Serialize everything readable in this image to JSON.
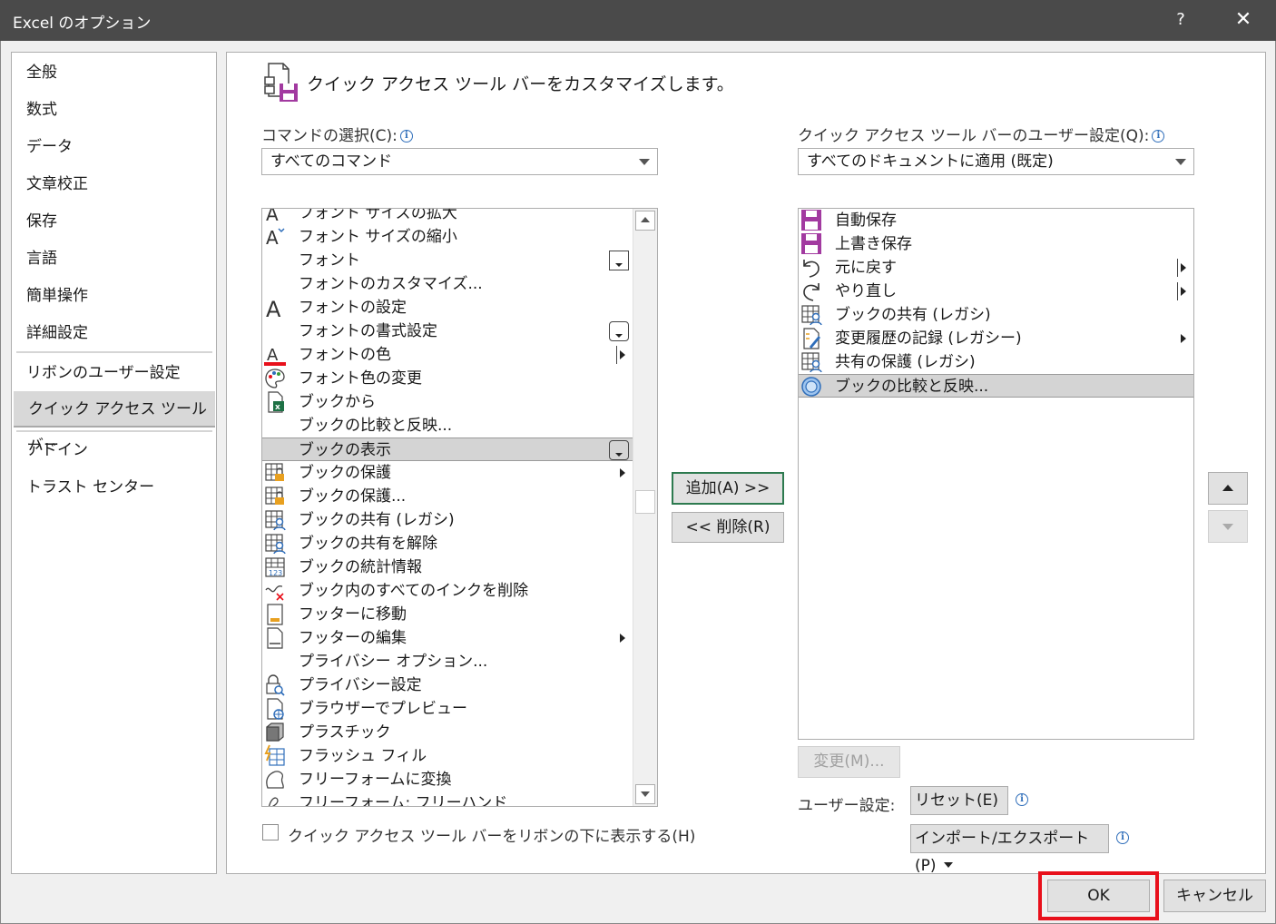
{
  "window": {
    "title": "Excel のオプション",
    "help": "?",
    "close": "✕"
  },
  "nav": {
    "items": [
      {
        "label": "全般"
      },
      {
        "label": "数式"
      },
      {
        "label": "データ"
      },
      {
        "label": "文章校正"
      },
      {
        "label": "保存"
      },
      {
        "label": "言語"
      },
      {
        "label": "簡単操作"
      },
      {
        "label": "詳細設定"
      },
      {
        "label": "リボンのユーザー設定"
      },
      {
        "label": "クイック アクセス ツール バー"
      },
      {
        "label": "アドイン"
      },
      {
        "label": "トラスト センター"
      }
    ],
    "active": "クイック アクセス ツール バー"
  },
  "main": {
    "heading": "クイック アクセス ツール バーをカスタマイズします。",
    "commands_label": "コマンドの選択(C):",
    "commands_value": "すべてのコマンド",
    "qat_label": "クイック アクセス ツール バーのユーザー設定(Q):",
    "qat_value": "すべてのドキュメントに適用 (既定)",
    "commands": [
      {
        "label": "フォント サイズの拡大",
        "icon": "font-grow-icon"
      },
      {
        "label": "フォント サイズの縮小",
        "icon": "font-shrink-icon"
      },
      {
        "label": "フォント",
        "icon": "none",
        "extra": "font-box"
      },
      {
        "label": "フォントのカスタマイズ...",
        "icon": "none"
      },
      {
        "label": "フォントの設定",
        "icon": "font-icon"
      },
      {
        "label": "フォントの書式設定",
        "icon": "none",
        "extra": "dropdown"
      },
      {
        "label": "フォントの色",
        "icon": "font-color-icon",
        "extra": "split"
      },
      {
        "label": "フォント色の変更",
        "icon": "palette-icon"
      },
      {
        "label": "ブックから",
        "icon": "excel-file-icon"
      },
      {
        "label": "ブックの比較と反映...",
        "icon": "none"
      },
      {
        "label": "ブックの表示",
        "icon": "none",
        "extra": "dropdown"
      },
      {
        "label": "ブックの保護",
        "icon": "protect-workbook-icon",
        "extra": "submenu"
      },
      {
        "label": "ブックの保護...",
        "icon": "protect-workbook-icon"
      },
      {
        "label": "ブックの共有 (レガシ)",
        "icon": "share-workbook-icon"
      },
      {
        "label": "ブックの共有を解除",
        "icon": "share-workbook-icon"
      },
      {
        "label": "ブックの統計情報",
        "icon": "statistics-icon"
      },
      {
        "label": "ブック内のすべてのインクを削除",
        "icon": "delete-ink-icon"
      },
      {
        "label": "フッターに移動",
        "icon": "footer-icon"
      },
      {
        "label": "フッターの編集",
        "icon": "footer-edit-icon",
        "extra": "submenu"
      },
      {
        "label": "プライバシー オプション...",
        "icon": "none"
      },
      {
        "label": "プライバシー設定",
        "icon": "privacy-icon"
      },
      {
        "label": "ブラウザーでプレビュー",
        "icon": "browser-preview-icon"
      },
      {
        "label": "プラスチック",
        "icon": "plastic-icon"
      },
      {
        "label": "フラッシュ フィル",
        "icon": "flash-fill-icon"
      },
      {
        "label": "フリーフォームに変換",
        "icon": "freeform-icon"
      },
      {
        "label": "フリーフォーム: フリーハンド",
        "icon": "freehand-icon"
      }
    ],
    "selected_command": "ブックの表示",
    "qat_items": [
      {
        "label": "自動保存",
        "icon": "autosave-icon"
      },
      {
        "label": "上書き保存",
        "icon": "save-icon"
      },
      {
        "label": "元に戻す",
        "icon": "undo-icon",
        "extra": "split"
      },
      {
        "label": "やり直し",
        "icon": "redo-icon",
        "extra": "split"
      },
      {
        "label": "ブックの共有 (レガシ)",
        "icon": "share-workbook-icon"
      },
      {
        "label": "変更履歴の記録 (レガシー)",
        "icon": "track-changes-icon",
        "extra": "submenu"
      },
      {
        "label": "共有の保護 (レガシ)",
        "icon": "protect-share-icon"
      },
      {
        "label": "ブックの比較と反映...",
        "icon": "compare-merge-icon"
      }
    ],
    "selected_qat": "ブックの比較と反映...",
    "add_button": "追加(A) >>",
    "remove_button": "<< 削除(R)",
    "modify_button": "変更(M)...",
    "customize_label": "ユーザー設定:",
    "reset_button": "リセット(E)",
    "import_export_button": "インポート/エクスポート(P)",
    "show_below_ribbon": "クイック アクセス ツール バーをリボンの下に表示する(H)",
    "show_below_ribbon_checked": false
  },
  "footer": {
    "ok": "OK",
    "cancel": "キャンセル"
  },
  "colors": {
    "titlebar": "#4a4a4a",
    "save_purple": "#a23aa0",
    "highlight": "#e8101b",
    "accent_green": "#2d7a4f",
    "info_blue": "#2f6eba"
  }
}
